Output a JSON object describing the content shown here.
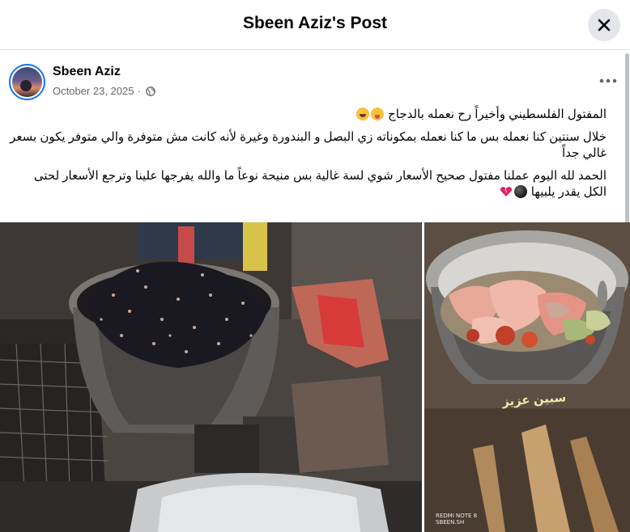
{
  "header": {
    "title": "Sbeen Aziz's Post",
    "close_icon": "close-icon"
  },
  "post": {
    "author": "Sbeen Aziz",
    "date": "October 23, 2025",
    "separator": "·",
    "audience_icon": "globe-icon",
    "more_icon": "more-options-icon",
    "paragraphs": {
      "p1": "المفتول الفلسطيني وأخيراً رح نعمله بالدجاج",
      "p2": "خلال سنتين كنا نعمله بس ما كنا نعمله بمكوناته زي البصل و البندورة وغيرة لأنه كانت مش متوفرة والي متوفر يكون بسعر غالي جداً",
      "p3": "الحمد لله اليوم عملنا مفتول صحيح الأسعار شوي لسة غالية بس منيحة نوعاً ما والله يفرجها علينا وترجع الأسعار لحتى الكل يقدر يلبيها"
    }
  },
  "photos": {
    "right_signature": "سبين عزيز",
    "right_watermark_line1": "REDMI NOTE 8",
    "right_watermark_line2": "SBEEN.SH"
  },
  "colors": {
    "accent": "#1877f2",
    "header_bg": "#ffffff",
    "secondary_text": "#65676b",
    "button_bg": "#e4e6eb"
  }
}
